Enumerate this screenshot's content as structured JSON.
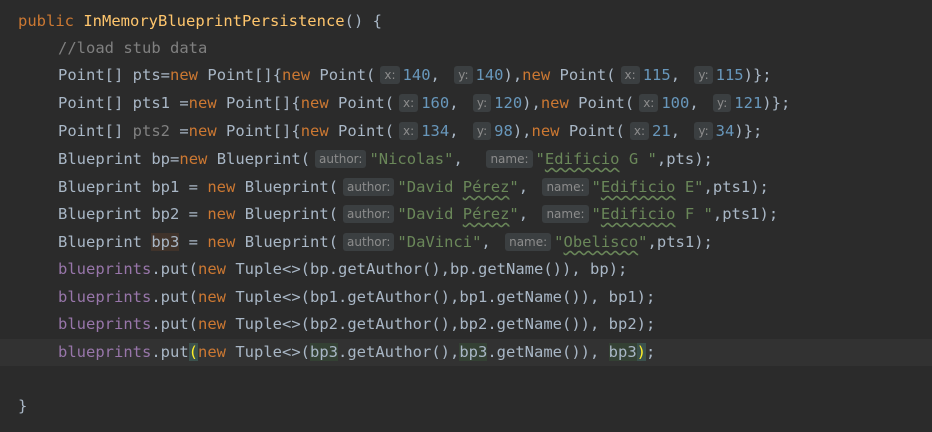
{
  "code": {
    "constructor": {
      "modifier": "public",
      "name": "InMemoryBlueprintPersistence",
      "signature_end": "() {"
    },
    "comment": "//load stub data",
    "points": [
      {
        "decl_type": "Point[]",
        "var": "pts",
        "assign": "=",
        "p1": {
          "x": "140",
          "y": "140"
        },
        "p2": {
          "x": "115",
          "y": "115"
        }
      },
      {
        "decl_type": "Point[]",
        "var": "pts1",
        "assign": " =",
        "p1": {
          "x": "160",
          "y": "120"
        },
        "p2": {
          "x": "100",
          "y": "121"
        }
      },
      {
        "decl_type": "Point[]",
        "var": "pts2",
        "assign": " =",
        "p1": {
          "x": "134",
          "y": "98"
        },
        "p2": {
          "x": "21",
          "y": "34"
        }
      }
    ],
    "blueprints": [
      {
        "var": "bp",
        "assign": "=",
        "author": "\"Nicolas\"",
        "name_open": "\"",
        "name_word": "Edificio",
        "name_rest": " G \"",
        "pts": "pts"
      },
      {
        "var": "bp1",
        "assign": " = ",
        "author_open": "\"David ",
        "author_word": "Pérez",
        "author_close": "\"",
        "name_open": "\"",
        "name_word": "Edificio",
        "name_rest": " E\"",
        "pts": "pts1"
      },
      {
        "var": "bp2",
        "assign": " = ",
        "author_open": "\"David ",
        "author_word": "Pérez",
        "author_close": "\"",
        "name_open": "\"",
        "name_word": "Edificio",
        "name_rest": " F \"",
        "pts": "pts1"
      },
      {
        "var": "bp3",
        "assign": " = ",
        "author": "\"DaVinci\"",
        "name_open": "\"",
        "name_word": "Obelisco",
        "name_rest": "\"",
        "pts": "pts1"
      }
    ],
    "puts": [
      "bp",
      "bp1",
      "bp2",
      "bp3"
    ],
    "closing_brace": "}",
    "tokens": {
      "new": "new",
      "point": "Point",
      "point_array": "Point[]",
      "blueprint": "Blueprint",
      "blueprints_field": "blueprints",
      "put": ".put(",
      "tuple": "Tuple<>",
      "get_author": ".getAuthor()",
      "get_name": ".getName()",
      "hint_x": "x:",
      "hint_y": "y:",
      "hint_author": "author:",
      "hint_name": "name:"
    }
  },
  "colors": {
    "background": "#2b2b2b",
    "keyword": "#cc7832",
    "function": "#ffc66d",
    "string": "#6a8759",
    "number": "#6897bb",
    "field": "#9876aa",
    "comment": "#808080"
  }
}
